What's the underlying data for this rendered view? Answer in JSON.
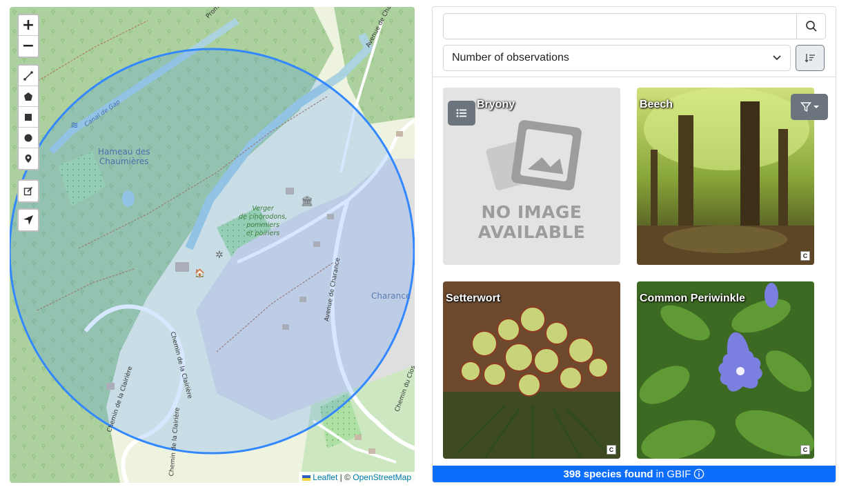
{
  "map": {
    "zoom_in_label": "+",
    "zoom_out_label": "−",
    "labels": {
      "hamlet": "Hameau des\nChaumières",
      "orchard": "Verger\nde cinorodons,\npommiers\net poiriers",
      "district": "Charance",
      "road_avenue_top": "Avenue de Charance",
      "road_avenue_mid": "Avenue de Charance",
      "road_clairiere_1": "Chemin de la Clairière",
      "road_clairiere_2": "Chemin de la Clairière",
      "road_clairiere_3": "Chemin de la Clairière",
      "road_clos": "Chemin du Clos",
      "canal": "Canal de Gap",
      "promenade": "Promen"
    },
    "attribution": {
      "leaflet": "Leaflet",
      "separator": " | © ",
      "osm": "OpenStreetMap"
    },
    "draw_tools": [
      "polyline-icon",
      "polygon-icon",
      "rectangle-icon",
      "circle-icon",
      "marker-icon"
    ],
    "colors": {
      "circle_stroke": "#3388ff",
      "circle_fill": "#3388ff"
    }
  },
  "panel": {
    "search": {
      "value": "",
      "placeholder": ""
    },
    "sort": {
      "selected": "Number of observations"
    },
    "cards": [
      {
        "title": "Bryony",
        "image": "no-image",
        "no_image_line1": "NO IMAGE",
        "no_image_line2": "AVAILABLE"
      },
      {
        "title": "Beech",
        "image": "beech-forest-photo",
        "license": "C"
      },
      {
        "title": "Setterwort",
        "image": "hellebore-photo",
        "license": "C"
      },
      {
        "title": "Common Periwinkle",
        "image": "periwinkle-photo",
        "license": "C"
      }
    ],
    "footer": {
      "count": "398 species found",
      "suffix": "in GBIF"
    }
  }
}
